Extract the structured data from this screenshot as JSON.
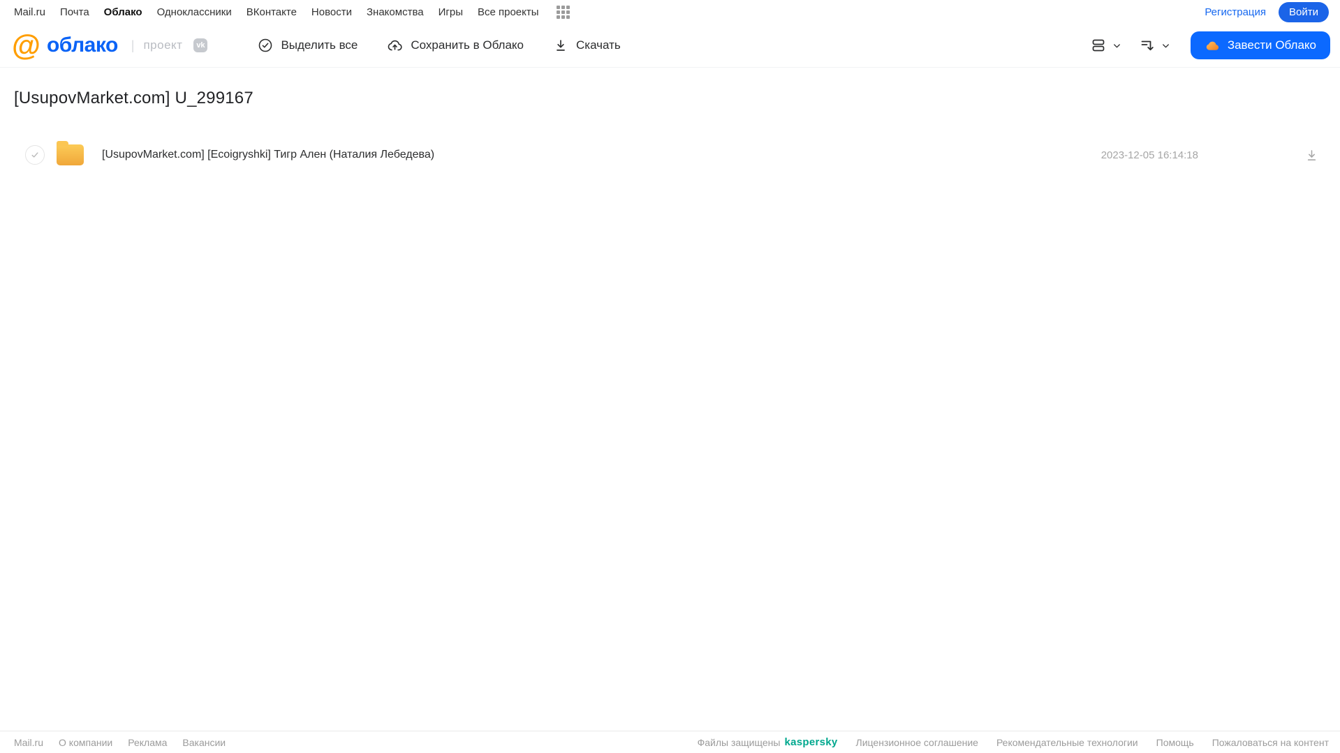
{
  "topnav": {
    "links": [
      {
        "label": "Mail.ru"
      },
      {
        "label": "Почта"
      },
      {
        "label": "Облако"
      },
      {
        "label": "Одноклассники"
      },
      {
        "label": "ВКонтакте"
      },
      {
        "label": "Новости"
      },
      {
        "label": "Знакомства"
      },
      {
        "label": "Игры"
      },
      {
        "label": "Все проекты"
      }
    ],
    "registration_label": "Регистрация",
    "login_label": "Войти"
  },
  "toolbar": {
    "logo_at": "@",
    "logo_text": "облако",
    "logo_divider": "|",
    "project_label": "проект",
    "vk_badge_label": "vk",
    "select_all_label": "Выделить все",
    "save_to_cloud_label": "Сохранить в Облако",
    "download_label": "Скачать",
    "cta_label": "Завести Облако"
  },
  "main": {
    "title": "[UsupovMarket.com] U_299167",
    "files": [
      {
        "name": "[UsupovMarket.com] [Ecoigryshki] Тигр Ален (Наталия Лебедева)",
        "date": "2023-12-05 16:14:18"
      }
    ]
  },
  "footer": {
    "links_left": [
      {
        "label": "Mail.ru"
      },
      {
        "label": "О компании"
      },
      {
        "label": "Реклама"
      },
      {
        "label": "Вакансии"
      }
    ],
    "protected_label": "Файлы защищены",
    "kaspersky_label": "kaspersky",
    "links_right": [
      {
        "label": "Лицензионное соглашение"
      },
      {
        "label": "Рекомендательные технологии"
      },
      {
        "label": "Помощь"
      },
      {
        "label": "Пожаловаться на контент"
      }
    ]
  },
  "colors": {
    "accent_blue": "#0b69ff",
    "logo_blue": "#0b63f6",
    "logo_orange": "#ff9e00",
    "kaspersky_teal": "#00a88e",
    "folder_yellow": "#f5b63e"
  }
}
